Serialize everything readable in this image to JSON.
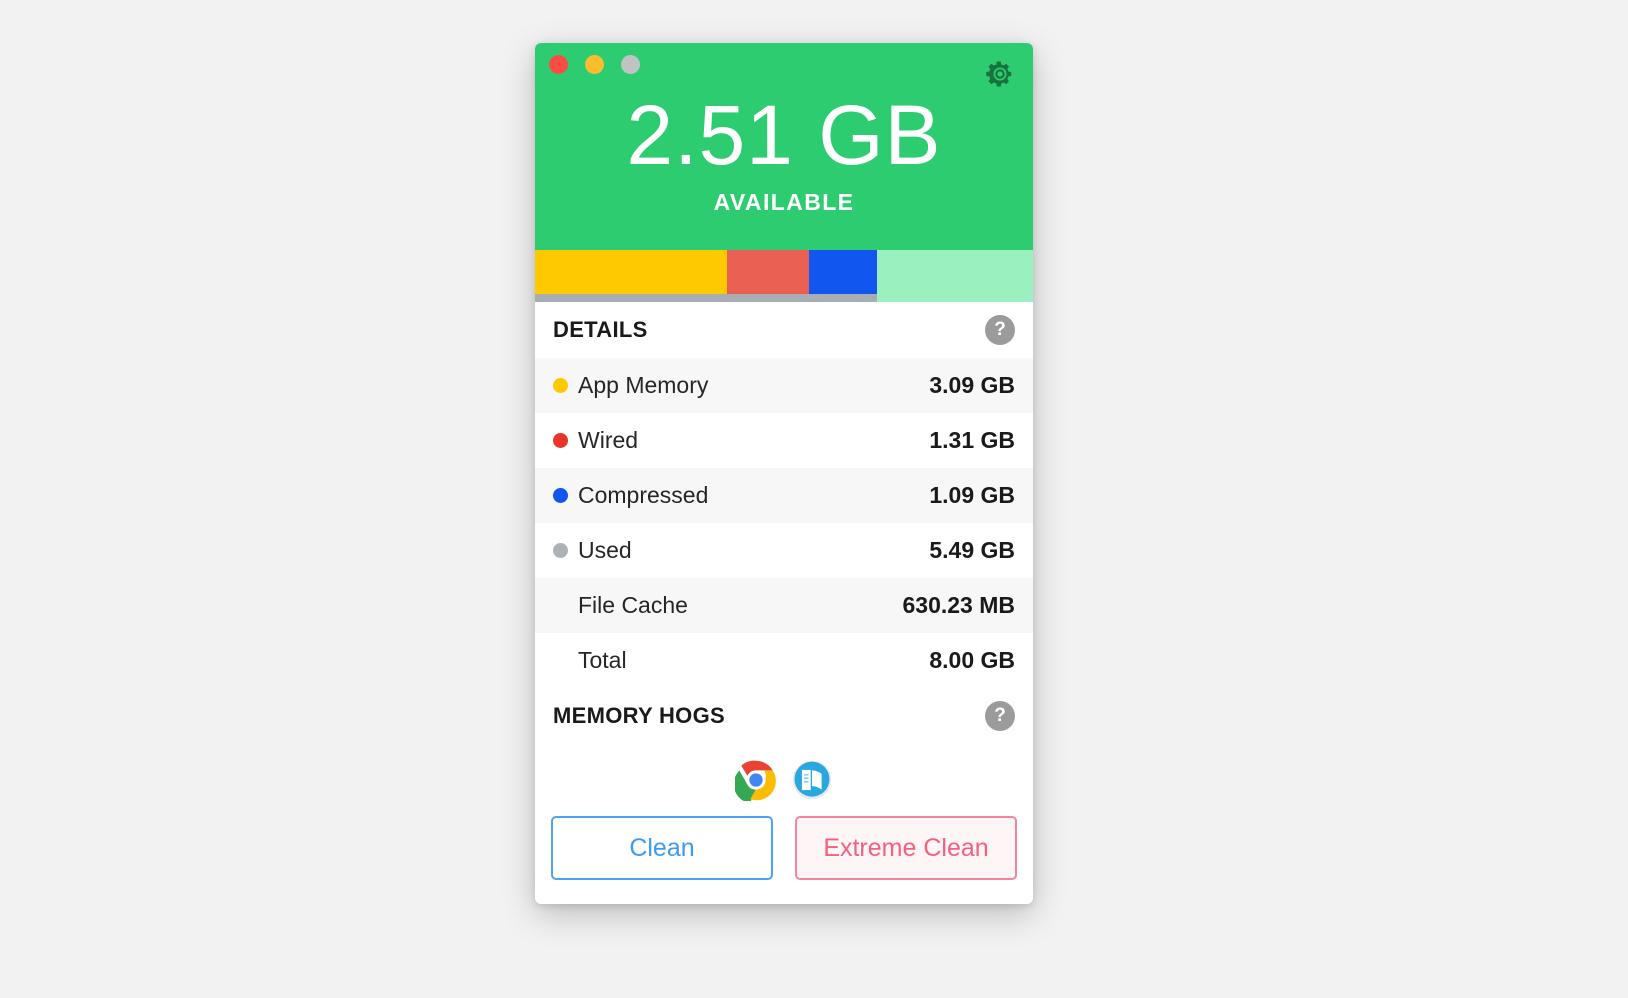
{
  "window": {
    "traffic_lights": [
      {
        "name": "close",
        "color": "#fb4d42"
      },
      {
        "name": "minimize",
        "color": "#fbbc2e"
      },
      {
        "name": "zoom",
        "color": "#c0c2c4"
      }
    ],
    "gear_icon": "gear-icon",
    "header_color": "#2ecc71"
  },
  "header": {
    "available_value": "2.51 GB",
    "available_label": "AVAILABLE"
  },
  "memory_bar": {
    "segments": [
      {
        "name": "app-memory",
        "color": "#ffc900",
        "percent": 38.6
      },
      {
        "name": "wired",
        "color": "#ea6153",
        "percent": 16.4
      },
      {
        "name": "compressed",
        "color": "#1256f0",
        "percent": 13.6
      },
      {
        "name": "free",
        "color": "#9bf0bf",
        "percent": 31.4
      }
    ],
    "used_underline_percent": 68.6,
    "underline_color": "#a8adb3"
  },
  "details": {
    "title": "DETAILS",
    "help_label": "?",
    "rows": [
      {
        "dot": "#ffc900",
        "label": "App Memory",
        "value": "3.09 GB",
        "shade": "alt"
      },
      {
        "dot": "#e8342a",
        "label": "Wired",
        "value": "1.31 GB",
        "shade": "plain"
      },
      {
        "dot": "#1256f0",
        "label": "Compressed",
        "value": "1.09 GB",
        "shade": "alt"
      },
      {
        "dot": "#aeb2b7",
        "label": "Used",
        "value": "5.49 GB",
        "shade": "plain"
      },
      {
        "dot": null,
        "label": "File Cache",
        "value": "630.23 MB",
        "shade": "alt"
      },
      {
        "dot": null,
        "label": "Total",
        "value": "8.00 GB",
        "shade": "plain"
      }
    ]
  },
  "memory_hogs": {
    "title": "MEMORY HOGS",
    "help_label": "?",
    "apps": [
      {
        "name": "google-chrome-icon",
        "label": "Google Chrome"
      },
      {
        "name": "dictionary-icon",
        "label": "Dictionary"
      }
    ]
  },
  "actions": {
    "clean_label": "Clean",
    "extreme_clean_label": "Extreme Clean",
    "clean_color": "#3b9bf5",
    "extreme_color": "#f4607f"
  }
}
